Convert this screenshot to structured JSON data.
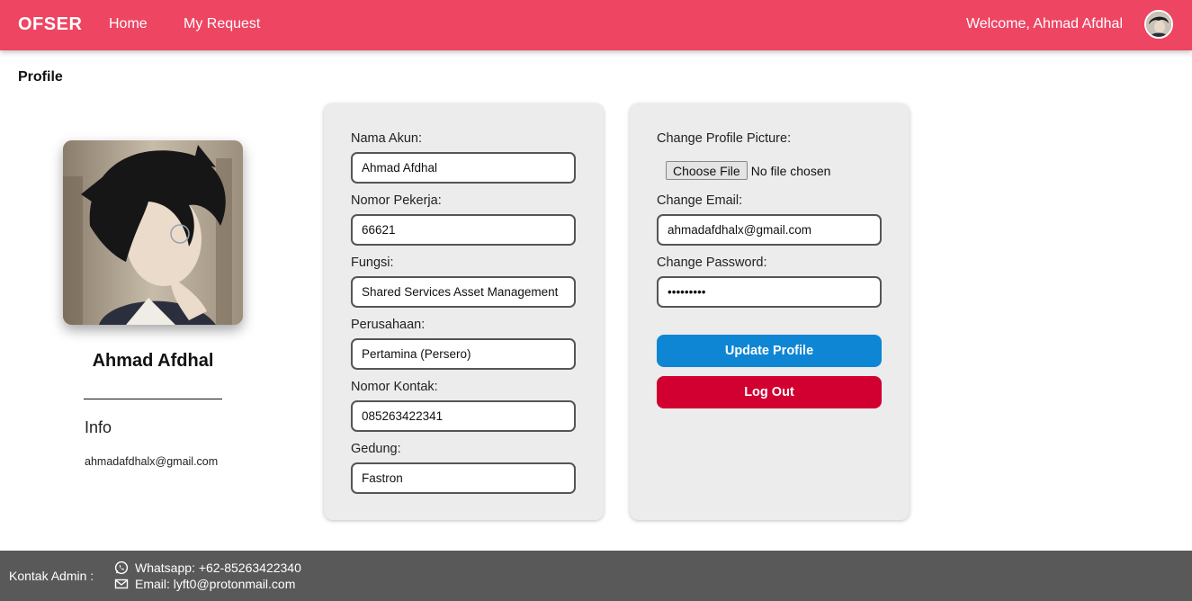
{
  "navbar": {
    "brand": "OFSER",
    "links": {
      "home": "Home",
      "my_request": "My Request"
    },
    "welcome": "Welcome, Ahmad Afdhal",
    "accent_color": "#ee4562"
  },
  "page": {
    "title": "Profile"
  },
  "profile": {
    "name": "Ahmad Afdhal",
    "info_heading": "Info",
    "email": "ahmadafdhalx@gmail.com"
  },
  "account_form": {
    "nama_akun": {
      "label": "Nama Akun:",
      "value": "Ahmad Afdhal"
    },
    "nomor_pekerja": {
      "label": "Nomor Pekerja:",
      "value": "66621"
    },
    "fungsi": {
      "label": "Fungsi:",
      "value": "Shared Services Asset Management"
    },
    "perusahaan": {
      "label": "Perusahaan:",
      "value": "Pertamina (Persero)"
    },
    "nomor_kontak": {
      "label": "Nomor Kontak:",
      "value": "085263422341"
    },
    "gedung": {
      "label": "Gedung:",
      "value": "Fastron"
    }
  },
  "settings_form": {
    "picture": {
      "label": "Change Profile Picture:",
      "button": "Choose File",
      "status": "No file chosen"
    },
    "email": {
      "label": "Change Email:",
      "value": "ahmadafdhalx@gmail.com"
    },
    "password": {
      "label": "Change Password:",
      "value": "password1"
    },
    "update_button": "Update Profile",
    "logout_button": "Log Out",
    "update_color": "#0e86d4",
    "logout_color": "#d10031"
  },
  "footer": {
    "label": "Kontak Admin :",
    "whatsapp": "Whatsapp: +62-85263422340",
    "email": "Email: lyft0@protonmail.com",
    "icons": [
      "whatsapp-icon",
      "mail-icon"
    ]
  }
}
